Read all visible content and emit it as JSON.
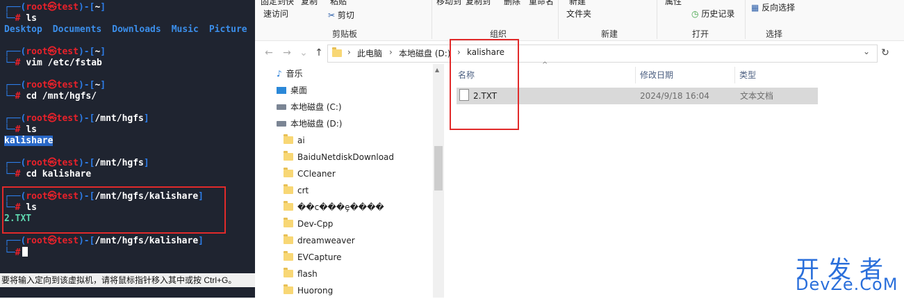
{
  "terminal": {
    "prompts": [
      {
        "user": "root",
        "host": "test",
        "path": "~",
        "cmd": "ls"
      },
      {
        "user": "root",
        "host": "test",
        "path": "~",
        "cmd": "vim /etc/fstab"
      },
      {
        "user": "root",
        "host": "test",
        "path": "~",
        "cmd": "cd /mnt/hgfs/"
      },
      {
        "user": "root",
        "host": "test",
        "path": "/mnt/hgfs",
        "cmd": "ls"
      },
      {
        "user": "root",
        "host": "test",
        "path": "/mnt/hgfs",
        "cmd": "cd kalishare"
      },
      {
        "user": "root",
        "host": "test",
        "path": "/mnt/hgfs/kalishare",
        "cmd": "ls"
      },
      {
        "user": "root",
        "host": "test",
        "path": "/mnt/hgfs/kalishare",
        "cmd": ""
      }
    ],
    "ls_home": [
      "Desktop",
      "Documents",
      "Downloads",
      "Music",
      "Picture"
    ],
    "ls_hgfs": "kalishare",
    "ls_kalishare": "2.TXT",
    "skull": "㉿",
    "hash": "#",
    "status_bar": "要将输入定向到该虚拟机，请将鼠标指针移入其中或按 Ctrl+G。"
  },
  "ribbon": {
    "top_items": [
      "固定到快",
      "复制",
      "粘贴",
      "移动到",
      "复制到",
      "删除",
      "重命名",
      "新建",
      "属性"
    ],
    "quick_access": "速访问",
    "cut": "剪切",
    "new_folder": "文件夹",
    "history": "历史记录",
    "invert": "反向选择",
    "groups": [
      "剪贴板",
      "组织",
      "新建",
      "打开",
      "选择"
    ]
  },
  "address": {
    "crumbs": [
      "此电脑",
      "本地磁盘 (D:)",
      "kalishare"
    ]
  },
  "nav": {
    "items": [
      {
        "icon": "music-icon",
        "label": "音乐"
      },
      {
        "icon": "desktop-icon",
        "label": "桌面"
      },
      {
        "icon": "drive-icon",
        "label": "本地磁盘 (C:)"
      },
      {
        "icon": "drive-icon",
        "label": "本地磁盘 (D:)"
      },
      {
        "icon": "folder-icon",
        "label": "ai"
      },
      {
        "icon": "folder-icon",
        "label": "BaiduNetdiskDownload"
      },
      {
        "icon": "folder-icon",
        "label": "CCleaner"
      },
      {
        "icon": "folder-icon",
        "label": "crt"
      },
      {
        "icon": "folder-icon",
        "label": "��c���ȩ����"
      },
      {
        "icon": "folder-icon",
        "label": "Dev-Cpp"
      },
      {
        "icon": "folder-icon",
        "label": "dreamweaver"
      },
      {
        "icon": "folder-icon",
        "label": "EVCapture"
      },
      {
        "icon": "folder-icon",
        "label": "flash"
      },
      {
        "icon": "folder-icon",
        "label": "Huorong"
      }
    ]
  },
  "files": {
    "headers": [
      "名称",
      "修改日期",
      "类型"
    ],
    "rows": [
      {
        "name": "2.TXT",
        "date": "2024/9/18 16:04",
        "type": "文本文档"
      }
    ]
  },
  "watermark": {
    "cn": "开发者",
    "en": "DevZe.CoM"
  }
}
